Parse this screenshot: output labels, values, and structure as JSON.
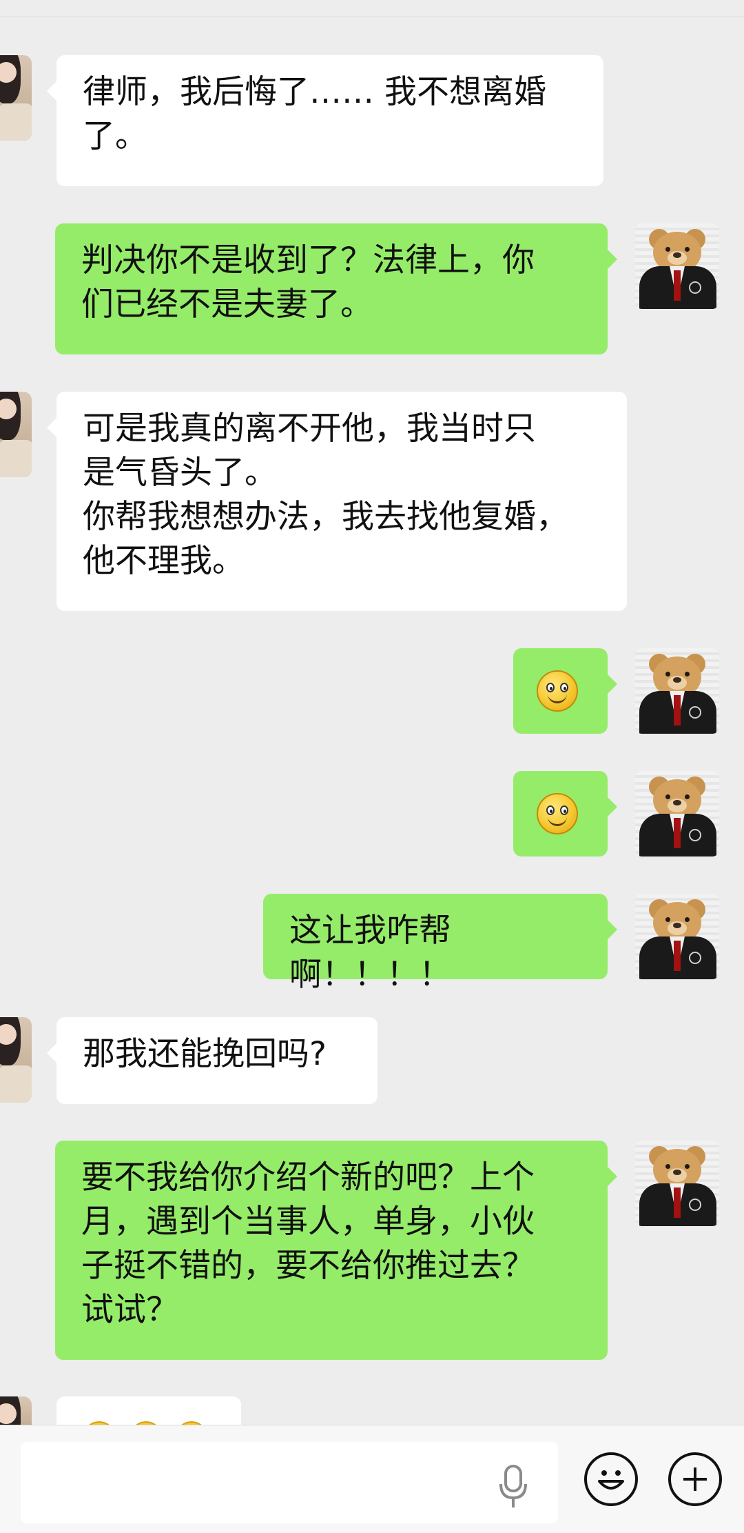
{
  "messages": [
    {
      "side": "in",
      "type": "text",
      "text": "律师，我后悔了…… 我不想离婚\n了。"
    },
    {
      "side": "out",
      "type": "text",
      "text": "判决你不是收到了？法律上，你\n们已经不是夫妻了。"
    },
    {
      "side": "in",
      "type": "text",
      "text": "可是我真的离不开他，我当时只\n是气昏头了。\n你帮我想想办法，我去找他复婚，\n他不理我。"
    },
    {
      "side": "out",
      "type": "emoji",
      "emoji": "smile-emoji"
    },
    {
      "side": "out",
      "type": "emoji",
      "emoji": "smile-emoji"
    },
    {
      "side": "out",
      "type": "text",
      "text": "这让我咋帮啊！！！！"
    },
    {
      "side": "in",
      "type": "text",
      "text": "那我还能挽回吗?"
    },
    {
      "side": "out",
      "type": "text",
      "text": "要不我给你介绍个新的吧？上个\n月，遇到个当事人，单身，小伙\n子挺不错的，要不给你推过去？\n试试？"
    }
  ],
  "input_bar": {
    "voice_icon": "microphone-icon",
    "emoji_icon": "smiley-face-icon",
    "more_icon": "plus-circle-icon"
  },
  "colors": {
    "background": "#EDEDED",
    "incoming_bubble": "#FFFFFF",
    "outgoing_bubble": "#95EC69"
  }
}
